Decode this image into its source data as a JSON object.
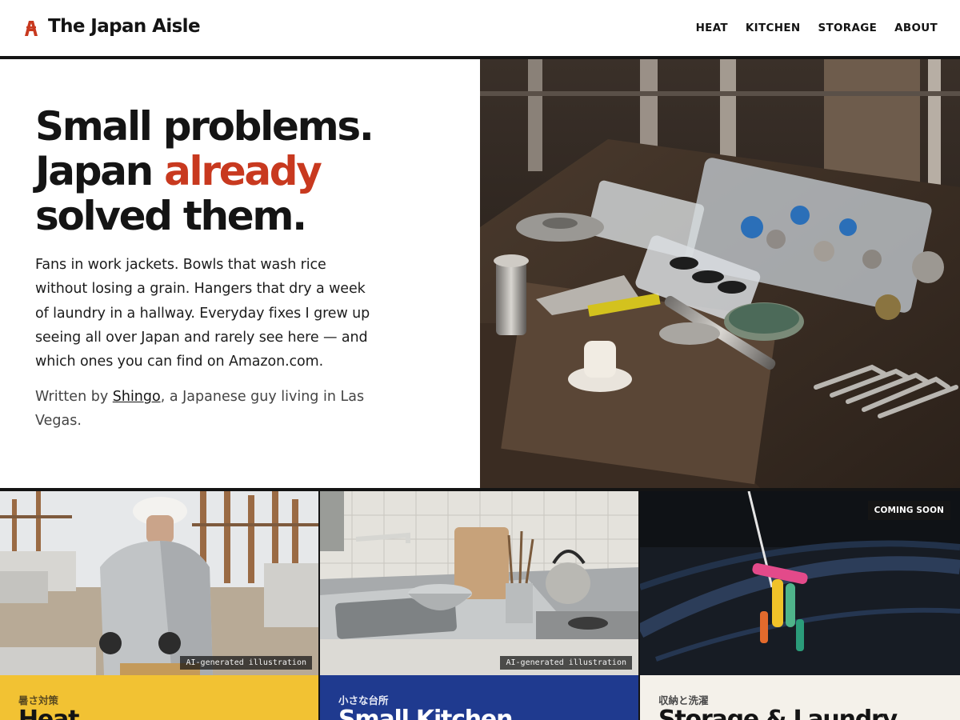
{
  "header": {
    "logo_text": "The Japan Aisle",
    "nav": [
      "HEAT",
      "KITCHEN",
      "STORAGE",
      "ABOUT"
    ]
  },
  "hero": {
    "headline_line1": "Small problems.",
    "headline_line2_start": "Japan ",
    "headline_line2_accent": "already",
    "headline_line3": "solved them.",
    "intro": "Fans in work jackets. Bowls that wash rice without losing a grain. Hangers that dry a week of laundry in a hallway. Everyday fixes I grew up seeing all over Japan and rarely see here — and which ones you can find on Amazon.com.",
    "byline_prefix": "Written by ",
    "byline_author": "Shingo",
    "byline_suffix": ", a Japanese guy living in Las Vegas."
  },
  "cards": [
    {
      "subtitle": "暑さ対策",
      "title": "Heat",
      "tag": "AI-generated illustration"
    },
    {
      "subtitle": "小さな台所",
      "title": "Small Kitchen",
      "tag": "AI-generated illustration"
    },
    {
      "subtitle": "収納と洗濯",
      "title": "Storage & Laundry",
      "badge": "COMING SOON"
    }
  ],
  "colors": {
    "accent": "#c8391f",
    "ink": "#141414",
    "heat_yellow": "#f2c233",
    "kitchen_blue": "#1f3a8f",
    "storage_cream": "#f4f1ea"
  }
}
